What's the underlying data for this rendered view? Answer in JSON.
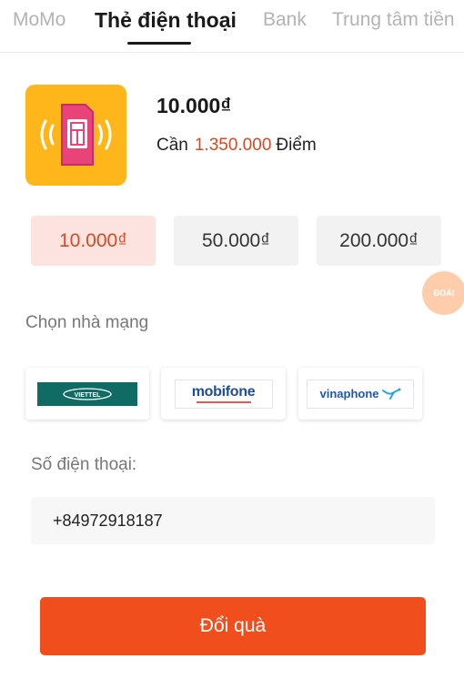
{
  "tabs": [
    {
      "label": "MoMo"
    },
    {
      "label": "Thẻ điện thoại"
    },
    {
      "label": "Bank"
    },
    {
      "label": "Trung tâm tiền"
    }
  ],
  "product": {
    "price": "10.000₫",
    "need_prefix": "Cần",
    "points": "1.350.000",
    "points_suffix": "Điểm"
  },
  "denominations": [
    {
      "label": "10.000₫",
      "selected": true
    },
    {
      "label": "50.000₫",
      "selected": false
    },
    {
      "label": "200.000₫",
      "selected": false
    }
  ],
  "float_bubble": {
    "text": "ĐOÁI"
  },
  "carrier_section": {
    "label": "Chọn nhà mạng"
  },
  "carriers": [
    {
      "name": "VIETTEL"
    },
    {
      "name": "mobifone"
    },
    {
      "name": "vinaphone"
    }
  ],
  "phone": {
    "label": "Số điện thoại:",
    "value": "+84972918187"
  },
  "submit": {
    "label": "Đổi quà"
  },
  "colors": {
    "accent": "#f04e1c",
    "selected_bg": "#fde3e0",
    "icon_bg": "#ffb61b"
  }
}
